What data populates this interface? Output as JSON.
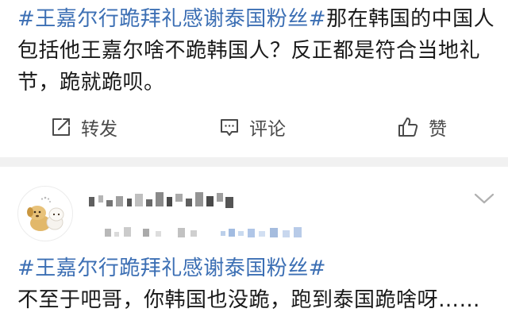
{
  "post1": {
    "hashtag": "#王嘉尔行跪拜礼感谢泰国粉丝#",
    "text": "那在韩国的中国人包括他王嘉尔啥不跪韩国人？反正都是符合当地礼节，跪就跪呗。"
  },
  "actions": {
    "repost_label": "转发",
    "comment_label": "评论",
    "like_label": "赞"
  },
  "post2": {
    "hashtag": "#王嘉尔行跪拜礼感谢泰国粉丝#",
    "text": "不至于吧哥，你韩国也没跪，跑到泰国跪啥呀……"
  },
  "colors": {
    "hashtag": "#3c6fb4",
    "text": "#1a1a1a",
    "action": "#4a4a4a",
    "divider": "#f1f1f1"
  },
  "icons": {
    "repost": "repost-icon",
    "comment": "comment-icon",
    "like": "like-icon",
    "menu": "chevron-down-icon"
  }
}
